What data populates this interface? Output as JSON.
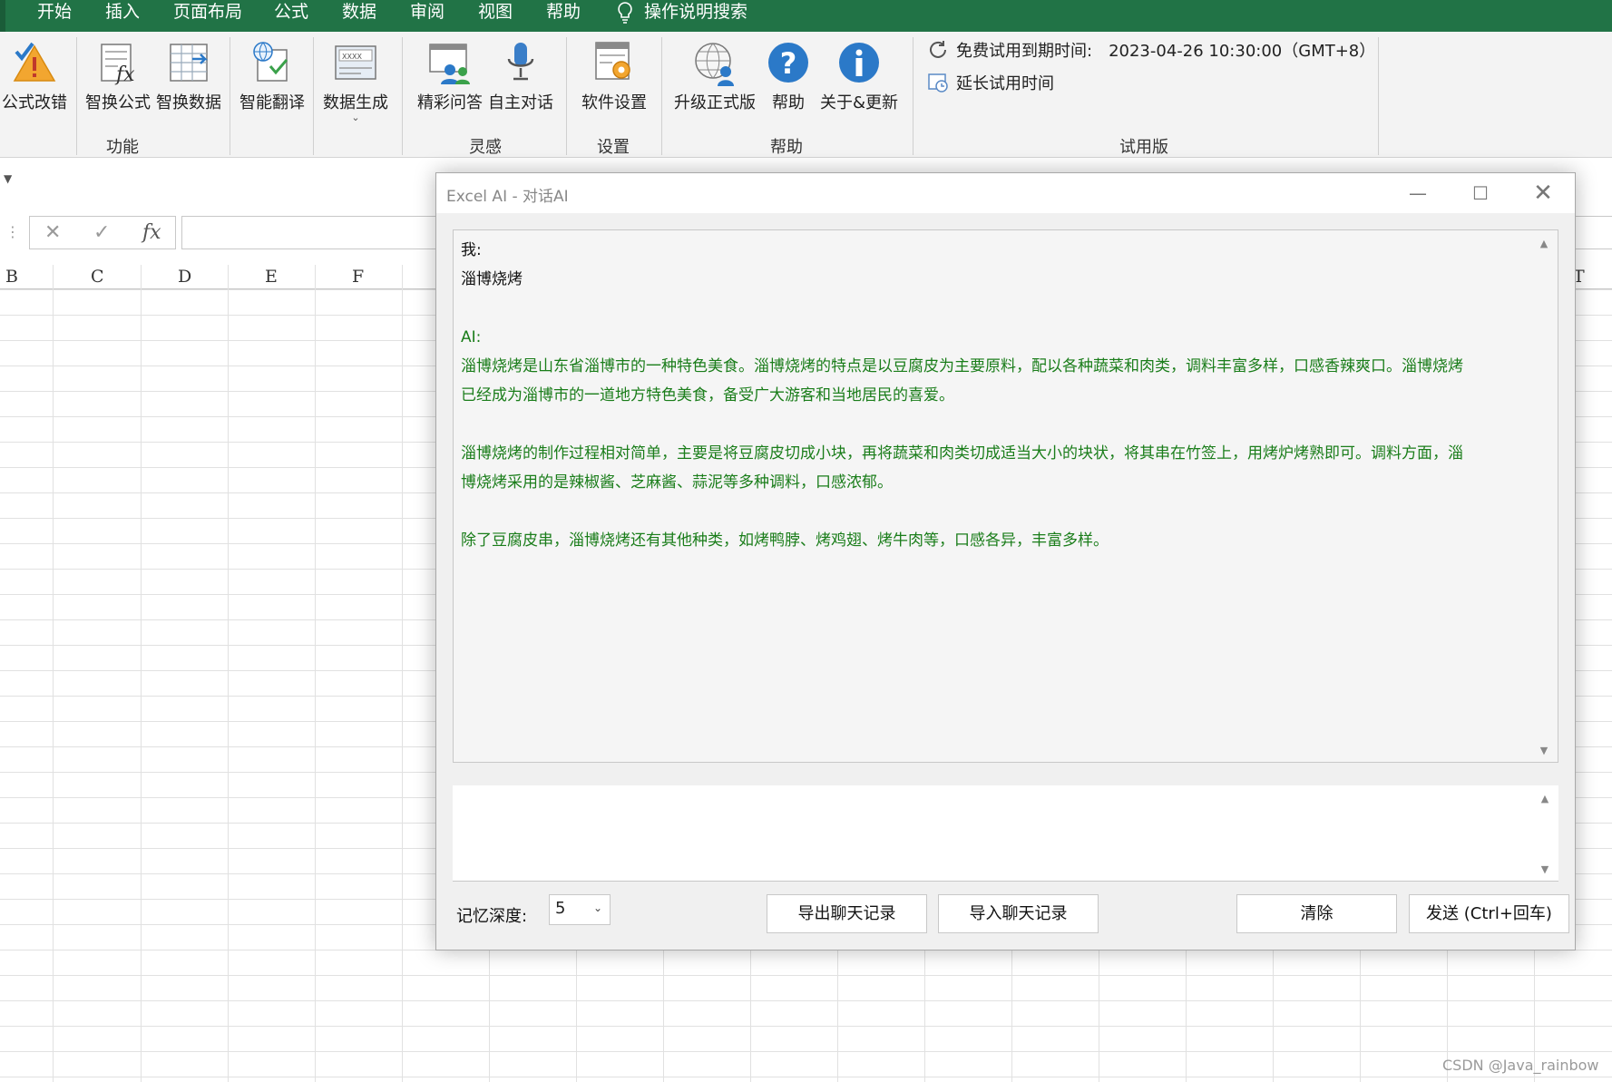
{
  "menu": {
    "tabs": [
      "开始",
      "插入",
      "页面布局",
      "公式",
      "数据",
      "审阅",
      "视图",
      "帮助"
    ],
    "search_label": "操作说明搜索"
  },
  "ribbon": {
    "buttons": {
      "formula_fix": "公式改错",
      "smart_formula": "智换公式",
      "smart_data": "智换数据",
      "smart_translate": "智能翻译",
      "data_generate": "数据生成",
      "qa": "精彩问答",
      "chat": "自主对话",
      "settings": "软件设置",
      "upgrade": "升级正式版",
      "help": "帮助",
      "about": "关于&更新"
    },
    "groups": {
      "features": "功能",
      "inspiration": "灵感",
      "settings": "设置",
      "help": "帮助",
      "trial": "试用版"
    },
    "trial": {
      "expiry_label": "免费试用到期时间:",
      "expiry_value": "2023-04-26 10:30:00（GMT+8）",
      "extend_label": "延长试用时间"
    }
  },
  "formula_bar": {
    "cancel": "✕",
    "confirm": "✓",
    "fx": "fx"
  },
  "sheet": {
    "columns": [
      "B",
      "C",
      "D",
      "E",
      "F",
      "T"
    ]
  },
  "dialog": {
    "title": "Excel AI - 对话AI",
    "chat": {
      "me_label": "我:",
      "me_message": "淄博烧烤",
      "ai_label": "AI:",
      "ai_paragraphs": [
        [
          "淄博烧烤是山东省淄博市的一种特色美食。淄博烧烤的特点是以豆腐皮为主要原料，配以各种蔬菜和肉类，调料丰富多样，口感香辣爽口。淄博烧烤",
          "已经成为淄博市的一道地方特色美食，备受广大游客和当地居民的喜爱。"
        ],
        [
          "淄博烧烤的制作过程相对简单，主要是将豆腐皮切成小块，再将蔬菜和肉类切成适当大小的块状，将其串在竹签上，用烤炉烤熟即可。调料方面，淄",
          "博烧烤采用的是辣椒酱、芝麻酱、蒜泥等多种调料，口感浓郁。"
        ],
        [
          "除了豆腐皮串，淄博烧烤还有其他种类，如烤鸭脖、烤鸡翅、烤牛肉等，口感各异，丰富多样。"
        ]
      ]
    },
    "memory_depth_label": "记忆深度:",
    "memory_depth_value": "5",
    "buttons": {
      "export": "导出聊天记录",
      "import": "导入聊天记录",
      "clear": "清除",
      "send": "发送 (Ctrl+回车)"
    }
  },
  "watermark": "CSDN @Java_rainbow",
  "colors": {
    "menubar": "#217346",
    "ai_text": "#1a7d1a",
    "accent_blue": "#2b79c8",
    "warning_orange": "#f0a030"
  }
}
